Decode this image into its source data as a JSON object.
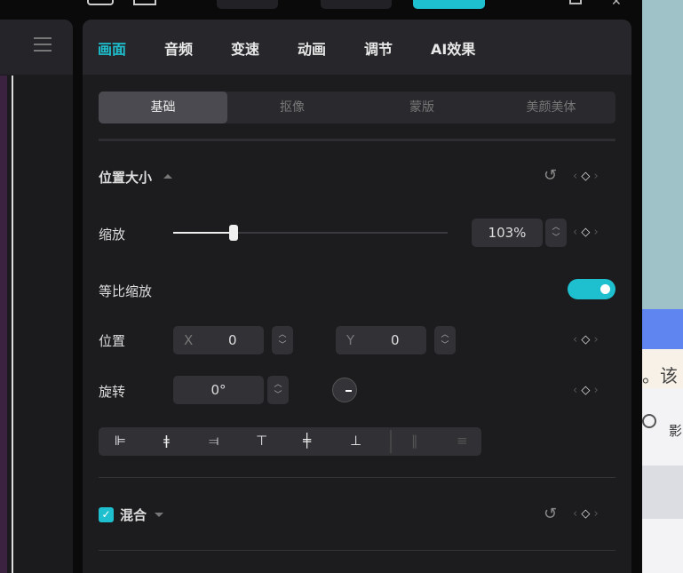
{
  "tabs": [
    "画面",
    "音频",
    "变速",
    "动画",
    "调节",
    "AI效果"
  ],
  "subtabs": [
    "基础",
    "抠像",
    "蒙版",
    "美颜美体"
  ],
  "section_position": {
    "title": "位置大小"
  },
  "scale": {
    "label": "缩放",
    "value": "103%",
    "slider_percent": 22
  },
  "uniform_scale": {
    "label": "等比缩放",
    "enabled": true
  },
  "position": {
    "label": "位置",
    "x_label": "X",
    "x": "0",
    "y_label": "Y",
    "y": "0"
  },
  "rotation": {
    "label": "旋转",
    "value": "0°"
  },
  "blend": {
    "label": "混合",
    "checked": true
  },
  "desktop": {
    "text1": "。该",
    "text2": "影"
  },
  "colors": {
    "accent": "#1ec0cf"
  }
}
